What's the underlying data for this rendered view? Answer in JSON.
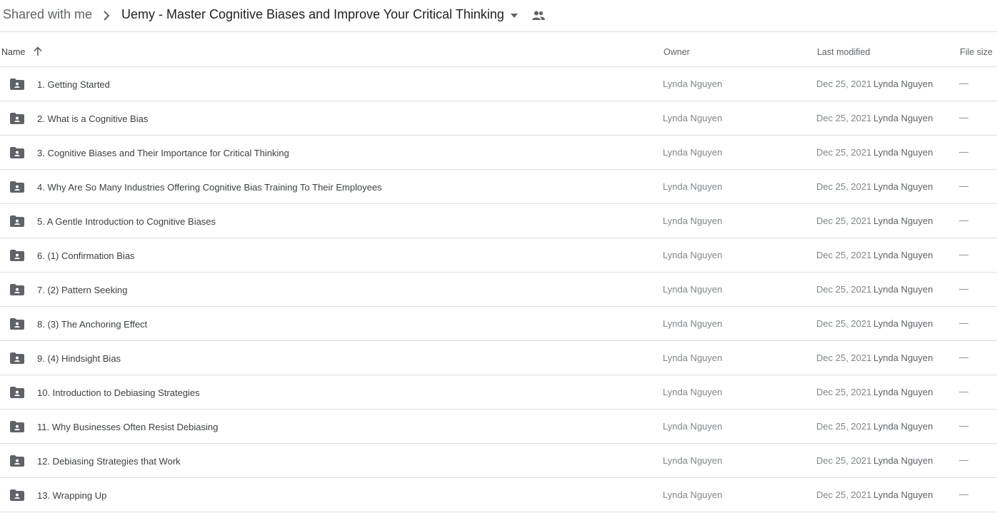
{
  "breadcrumb": {
    "root": "Shared with me",
    "current": "Uemy - Master Cognitive Biases and Improve Your Critical Thinking"
  },
  "columns": {
    "name": "Name",
    "owner": "Owner",
    "last_modified": "Last modified",
    "file_size": "File size"
  },
  "rows": [
    {
      "name": "1. Getting Started",
      "owner": "Lynda Nguyen",
      "date": "Dec 25, 2021",
      "modified_by": "Lynda Nguyen",
      "size": "—"
    },
    {
      "name": "2. What is a Cognitive Bias",
      "owner": "Lynda Nguyen",
      "date": "Dec 25, 2021",
      "modified_by": "Lynda Nguyen",
      "size": "—"
    },
    {
      "name": "3. Cognitive Biases and Their Importance for Critical Thinking",
      "owner": "Lynda Nguyen",
      "date": "Dec 25, 2021",
      "modified_by": "Lynda Nguyen",
      "size": "—"
    },
    {
      "name": "4. Why Are So Many Industries Offering Cognitive Bias Training To Their Employees",
      "owner": "Lynda Nguyen",
      "date": "Dec 25, 2021",
      "modified_by": "Lynda Nguyen",
      "size": "—"
    },
    {
      "name": "5. A Gentle Introduction to Cognitive Biases",
      "owner": "Lynda Nguyen",
      "date": "Dec 25, 2021",
      "modified_by": "Lynda Nguyen",
      "size": "—"
    },
    {
      "name": "6. (1) Confirmation Bias",
      "owner": "Lynda Nguyen",
      "date": "Dec 25, 2021",
      "modified_by": "Lynda Nguyen",
      "size": "—"
    },
    {
      "name": "7. (2) Pattern Seeking",
      "owner": "Lynda Nguyen",
      "date": "Dec 25, 2021",
      "modified_by": "Lynda Nguyen",
      "size": "—"
    },
    {
      "name": "8. (3) The Anchoring Effect",
      "owner": "Lynda Nguyen",
      "date": "Dec 25, 2021",
      "modified_by": "Lynda Nguyen",
      "size": "—"
    },
    {
      "name": "9. (4) Hindsight Bias",
      "owner": "Lynda Nguyen",
      "date": "Dec 25, 2021",
      "modified_by": "Lynda Nguyen",
      "size": "—"
    },
    {
      "name": "10. Introduction to Debiasing Strategies",
      "owner": "Lynda Nguyen",
      "date": "Dec 25, 2021",
      "modified_by": "Lynda Nguyen",
      "size": "—"
    },
    {
      "name": "11. Why Businesses Often Resist Debiasing",
      "owner": "Lynda Nguyen",
      "date": "Dec 25, 2021",
      "modified_by": "Lynda Nguyen",
      "size": "—"
    },
    {
      "name": "12. Debiasing Strategies that Work",
      "owner": "Lynda Nguyen",
      "date": "Dec 25, 2021",
      "modified_by": "Lynda Nguyen",
      "size": "—"
    },
    {
      "name": "13. Wrapping Up",
      "owner": "Lynda Nguyen",
      "date": "Dec 25, 2021",
      "modified_by": "Lynda Nguyen",
      "size": "—"
    }
  ],
  "icons": {
    "folder": "shared-folder-icon",
    "sort": "arrow-up-icon",
    "dropdown": "caret-down-icon",
    "shared": "people-icon"
  },
  "colors": {
    "icon": "#5f6368",
    "divider": "#dadce0"
  }
}
